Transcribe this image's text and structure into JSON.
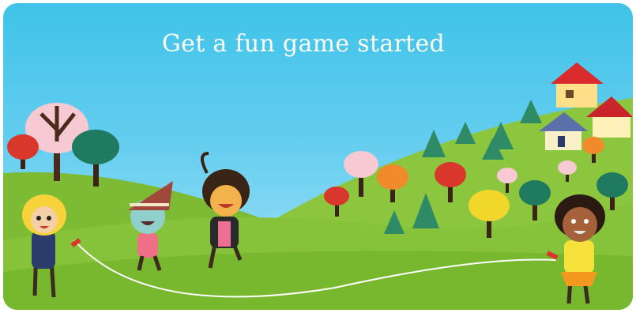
{
  "banner": {
    "headline": "Get a fun game started",
    "colors": {
      "sky_top": "#3fc3e8",
      "sky_bottom": "#a9e4f8",
      "grass_light": "#9fd04a",
      "grass_dark": "#6fb32e",
      "headline_text": "#ffffff"
    },
    "icons": [
      "tree-icon",
      "pine-tree-icon",
      "house-icon",
      "child-icon",
      "jump-rope-icon"
    ]
  }
}
